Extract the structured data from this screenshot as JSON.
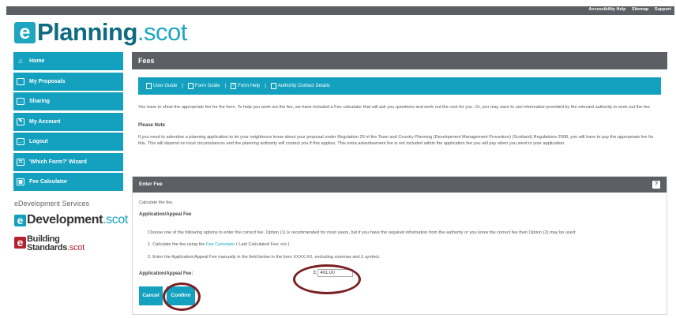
{
  "topbar": {
    "links": [
      "Accessibility Help",
      "Sitemap",
      "Support"
    ]
  },
  "logo": {
    "badge": "e",
    "name": "Planning",
    "domain": ".scot"
  },
  "sidebar": {
    "items": [
      {
        "label": "Home",
        "icon": "home-icon"
      },
      {
        "label": "My Proposals",
        "icon": "folder-icon"
      },
      {
        "label": "Sharing",
        "icon": "share-icon"
      },
      {
        "label": "My Account",
        "icon": "account-icon"
      },
      {
        "label": "Logout",
        "icon": "logout-icon"
      },
      {
        "label": "'Which Form?' Wizard",
        "icon": "wizard-icon"
      },
      {
        "label": "Fee Calculator",
        "icon": "calculator-icon"
      }
    ]
  },
  "services": {
    "title": "eDevelopment Services",
    "edevelopment": {
      "badge": "e",
      "name": "Development",
      "domain": ".scot"
    },
    "building": {
      "badge": "e",
      "line1": "Building",
      "line2": "Standards",
      "domain": ".scot"
    }
  },
  "main": {
    "title": "Fees",
    "help_links": [
      "User Guide",
      "Form Guide",
      "Form Help",
      "Authority Contact Details"
    ],
    "intro": "You have to show the appropriate fee for the form. To help you work out the fee, we have included a Fee calculator that will ask you questions and work out the cost for you. Or, you may want to use information provided by the relevant authority to work out the fee.",
    "note_title": "Please Note",
    "note_text": "If you need to advertise a planning application to let your neighbours know about your proposal under Regulation 20 of the Town and Country Planning (Development Management Procedure) (Scotland) Regulations 2008, you will have to pay the appropriate fee for this. This will depend on local circumstances and the planning authority will contact you if this applies. This extra advertisement fee is not included within the application fee you will pay when you send in your application."
  },
  "fee_panel": {
    "title": "Enter Fee",
    "calculate_text": "Calculate the fee.",
    "section_title": "Application/Appeal Fee",
    "choose_text": "Choose one of the following options to enter the correct fee. Option (1) is recommended for most users, but if you have the required information from the authority or you know the correct fee then Option (2) may be used:",
    "option1_prefix": "1. Calculate the fee using the ",
    "option1_link": "Fee Calculator",
    "option1_suffix": " ( Last Calculated Fee: n/a )",
    "option2": "2. Enter the Application/Appeal Fee manually in the field below in the form XXXX.XX, excluding commas and £ symbol.",
    "fee_label": "Application/Appeal Fee:",
    "currency": "£",
    "fee_value": "401.00",
    "cancel_label": "Cancel",
    "confirm_label": "Confirm"
  },
  "colors": {
    "brand": "#14a1bf",
    "header": "#5c6065",
    "annotation": "#7a1f22"
  }
}
